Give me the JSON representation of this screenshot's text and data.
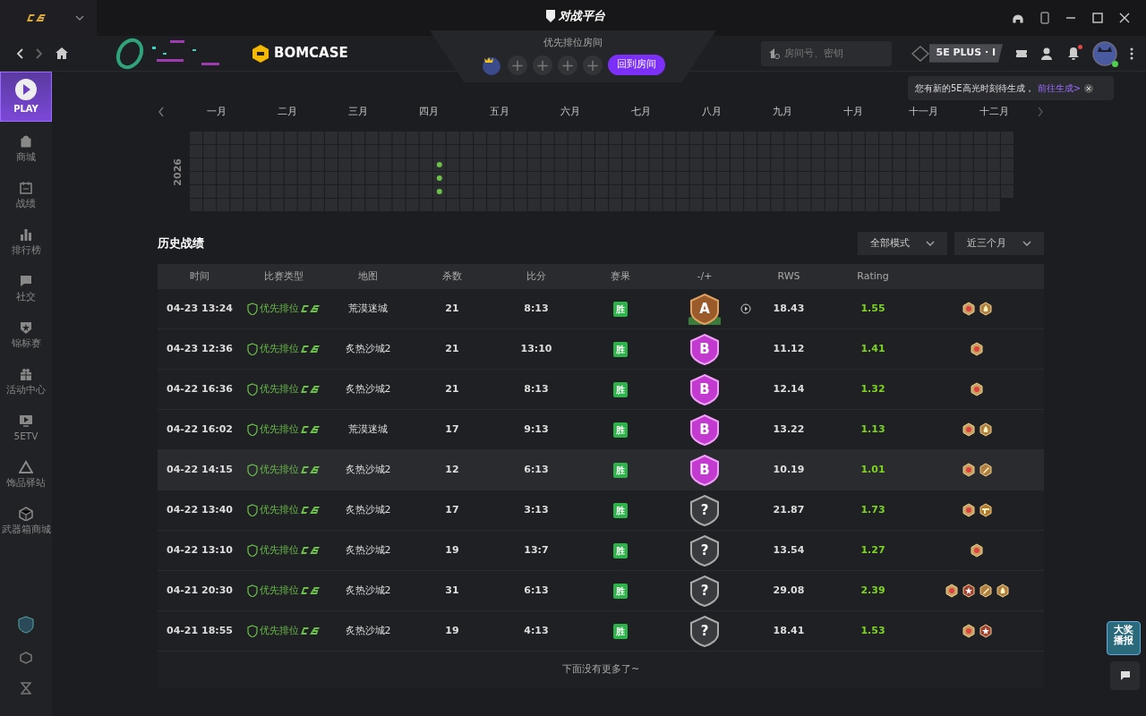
{
  "titlebar": {
    "platform_logo": "对战平台"
  },
  "header": {
    "brand": "BOMCASE",
    "room": {
      "title": "优先排位房间",
      "slots": [
        "+",
        "+",
        "+",
        "+"
      ],
      "return_button": "回到房间"
    },
    "search": {
      "placeholder": "房间号、密钥"
    },
    "plus_badge": "5E PLUS · I",
    "notification_unread": true,
    "online": true
  },
  "tooltip": {
    "text": "您有新的5E高光时刻待生成，",
    "link": "前往生成>"
  },
  "sidebar": {
    "play": "PLAY",
    "items": [
      {
        "label": "商城"
      },
      {
        "label": "战绩"
      },
      {
        "label": "排行榜"
      },
      {
        "label": "社交"
      },
      {
        "label": "锦标赛"
      },
      {
        "label": "活动中心"
      },
      {
        "label": "5ETV"
      },
      {
        "label": "饰品驿站"
      },
      {
        "label": "武器箱商城"
      }
    ]
  },
  "calendar": {
    "year": "2026",
    "months": [
      "一月",
      "二月",
      "三月",
      "四月",
      "五月",
      "六月",
      "七月",
      "八月",
      "九月",
      "十月",
      "十一月",
      "十二月"
    ]
  },
  "history": {
    "title": "历史战绩",
    "filters": [
      "全部模式",
      "近三个月"
    ],
    "columns": [
      "时间",
      "比赛类型",
      "地图",
      "杀数",
      "比分",
      "赛果",
      "-/+",
      "RWS",
      "Rating"
    ],
    "rows": [
      {
        "time": "04-23 13:24",
        "type": "优先排位",
        "map": "荒漠迷城",
        "kills": "21",
        "score": "8:13",
        "result": "胜",
        "grade": "A",
        "replay": true,
        "rws": "18.43",
        "rating": "1.55",
        "highlighted": false,
        "medals": [
          {
            "kind": "gold"
          },
          {
            "kind": "fire"
          }
        ]
      },
      {
        "time": "04-23 12:36",
        "type": "优先排位",
        "map": "炙热沙城2",
        "kills": "21",
        "score": "13:10",
        "result": "胜",
        "grade": "B",
        "replay": false,
        "rws": "11.12",
        "rating": "1.41",
        "highlighted": false,
        "medals": [
          {
            "kind": "gold"
          }
        ]
      },
      {
        "time": "04-22 16:36",
        "type": "优先排位",
        "map": "炙热沙城2",
        "kills": "21",
        "score": "8:13",
        "result": "胜",
        "grade": "B",
        "replay": false,
        "rws": "12.14",
        "rating": "1.32",
        "highlighted": false,
        "medals": [
          {
            "kind": "gold"
          }
        ]
      },
      {
        "time": "04-22 16:02",
        "type": "优先排位",
        "map": "荒漠迷城",
        "kills": "17",
        "score": "9:13",
        "result": "胜",
        "grade": "B",
        "replay": false,
        "rws": "13.22",
        "rating": "1.13",
        "highlighted": false,
        "medals": [
          {
            "kind": "gold"
          },
          {
            "kind": "fire"
          }
        ]
      },
      {
        "time": "04-22 14:15",
        "type": "优先排位",
        "map": "炙热沙城2",
        "kills": "12",
        "score": "6:13",
        "result": "胜",
        "grade": "B",
        "replay": false,
        "rws": "10.19",
        "rating": "1.01",
        "highlighted": true,
        "medals": [
          {
            "kind": "gold"
          },
          {
            "kind": "knife"
          }
        ]
      },
      {
        "time": "04-22 13:40",
        "type": "优先排位",
        "map": "炙热沙城2",
        "kills": "17",
        "score": "3:13",
        "result": "胜",
        "grade": "?",
        "replay": false,
        "rws": "21.87",
        "rating": "1.73",
        "highlighted": false,
        "medals": [
          {
            "kind": "gold"
          },
          {
            "kind": "gun"
          }
        ]
      },
      {
        "time": "04-22 13:10",
        "type": "优先排位",
        "map": "炙热沙城2",
        "kills": "19",
        "score": "13:7",
        "result": "胜",
        "grade": "?",
        "replay": false,
        "rws": "13.54",
        "rating": "1.27",
        "highlighted": false,
        "medals": [
          {
            "kind": "gold"
          }
        ]
      },
      {
        "time": "04-21 20:30",
        "type": "优先排位",
        "map": "炙热沙城2",
        "kills": "31",
        "score": "6:13",
        "result": "胜",
        "grade": "?",
        "replay": false,
        "rws": "29.08",
        "rating": "2.39",
        "highlighted": false,
        "medals": [
          {
            "kind": "gold"
          },
          {
            "kind": "star"
          },
          {
            "kind": "knife"
          },
          {
            "kind": "fire"
          }
        ]
      },
      {
        "time": "04-21 18:55",
        "type": "优先排位",
        "map": "炙热沙城2",
        "kills": "19",
        "score": "4:13",
        "result": "胜",
        "grade": "?",
        "replay": false,
        "rws": "18.41",
        "rating": "1.53",
        "highlighted": false,
        "medals": [
          {
            "kind": "gold"
          },
          {
            "kind": "star"
          }
        ]
      }
    ],
    "footer": "下面没有更多了~"
  },
  "float_badge": "大奖播报"
}
